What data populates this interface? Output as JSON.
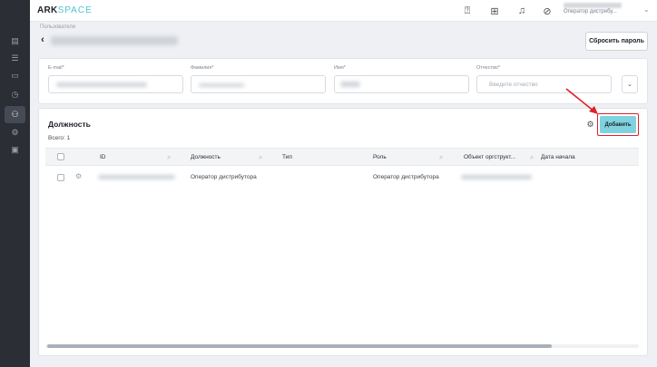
{
  "app": {
    "logo_primary": "ARK",
    "logo_secondary": "SPACE"
  },
  "header": {
    "user_role": "Оператор дистрибу..."
  },
  "breadcrumb": "Пользователи",
  "actions": {
    "reset_password": "Сбросить пароль"
  },
  "form": {
    "email_label": "E-mail*",
    "lastname_label": "Фамилия*",
    "firstname_label": "Имя*",
    "patronymic_label": "Отчество*",
    "patronymic_placeholder": "Введите отчество"
  },
  "positions": {
    "title": "Должность",
    "total": "Всего: 1",
    "add_label": "Добавить",
    "columns": [
      "ID",
      "Должность",
      "Тип",
      "Роль",
      "Объект оргструкт...",
      "Дата начала"
    ],
    "rows": [
      {
        "position": "Оператор дистрибутора",
        "role": "Оператор дистрибутора"
      }
    ]
  },
  "icons": {
    "rail": [
      "grid-icon",
      "layers-icon",
      "monitor-icon",
      "history-icon",
      "users-icon",
      "settings-icon",
      "calendar-icon"
    ],
    "header": [
      "help-icon",
      "apps-icon",
      "bell-icon",
      "compass-icon"
    ]
  },
  "colors": {
    "accent": "#7fd3df",
    "highlight": "#e0202a",
    "rail_bg": "#2b2e35"
  }
}
